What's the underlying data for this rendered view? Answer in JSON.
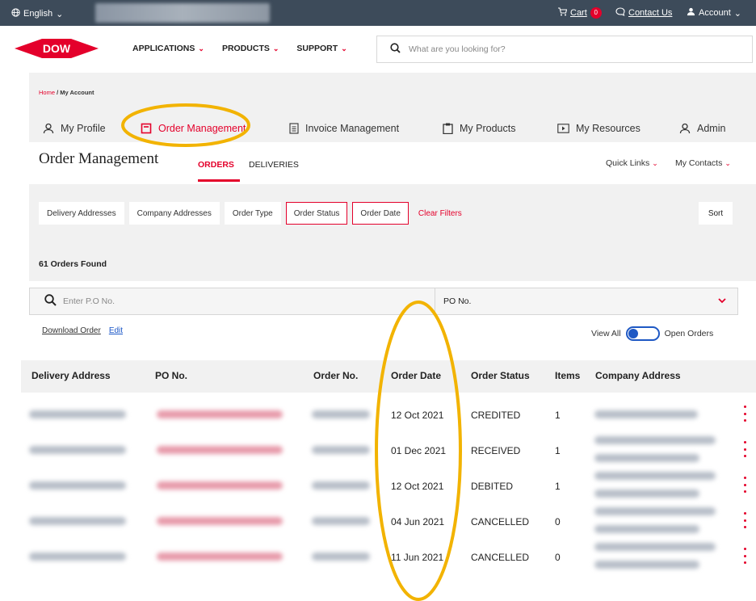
{
  "topbar": {
    "language": "English",
    "cart_label": "Cart",
    "cart_count": "0",
    "contact_label": "Contact Us",
    "account_label": "Account"
  },
  "header": {
    "logo_text": "DOW",
    "nav": [
      "APPLICATIONS",
      "PRODUCTS",
      "SUPPORT"
    ],
    "search_placeholder": "What are you looking for?"
  },
  "breadcrumb": {
    "home": "Home",
    "sep": " / ",
    "current": "My Account"
  },
  "account_tabs": [
    "My Profile",
    "Order Management",
    "Invoice Management",
    "My Products",
    "My Resources",
    "Admin"
  ],
  "order_mgmt": {
    "title": "Order Management",
    "sub_orders": "ORDERS",
    "sub_deliveries": "DELIVERIES",
    "quick_links": "Quick Links",
    "my_contacts": "My Contacts"
  },
  "filters": {
    "delivery_addresses": "Delivery Addresses",
    "company_addresses": "Company Addresses",
    "order_type": "Order Type",
    "order_status": "Order Status",
    "order_date": "Order Date",
    "clear": "Clear Filters",
    "sort": "Sort"
  },
  "orders_found": "61 Orders Found",
  "search_row": {
    "placeholder": "Enter P.O No.",
    "select_value": "PO No."
  },
  "actions": {
    "download": "Download Order",
    "edit": "Edit",
    "view_all": "View All",
    "open_orders": "Open Orders"
  },
  "table": {
    "headers": [
      "Delivery Address",
      "PO No.",
      "Order No.",
      "Order Date",
      "Order Status",
      "Items",
      "Company Address"
    ],
    "rows": [
      {
        "order_date": "12 Oct 2021",
        "status": "CREDITED",
        "items": "1"
      },
      {
        "order_date": "01 Dec 2021",
        "status": "RECEIVED",
        "items": "1"
      },
      {
        "order_date": "12 Oct 2021",
        "status": "DEBITED",
        "items": "1"
      },
      {
        "order_date": "04 Jun 2021",
        "status": "CANCELLED",
        "items": "0"
      },
      {
        "order_date": "11 Jun 2021",
        "status": "CANCELLED",
        "items": "0"
      }
    ]
  },
  "colors": {
    "accent": "#e4002b",
    "topbar": "#3d4b5a",
    "highlight": "#f2b300",
    "toggle": "#1e58c4"
  }
}
